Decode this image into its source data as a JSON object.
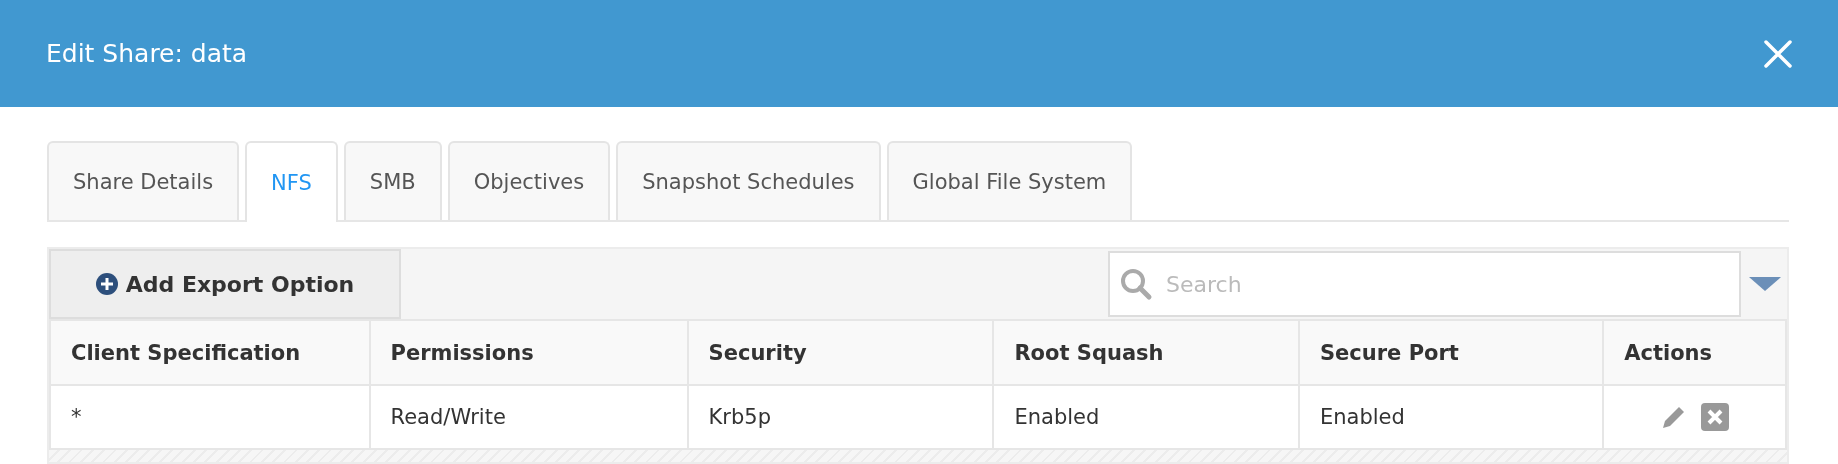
{
  "window": {
    "title": "Edit Share: data"
  },
  "tabs": [
    {
      "label": "Share Details",
      "selected": false
    },
    {
      "label": "NFS",
      "selected": true
    },
    {
      "label": "SMB",
      "selected": false
    },
    {
      "label": "Objectives",
      "selected": false
    },
    {
      "label": "Snapshot Schedules",
      "selected": false
    },
    {
      "label": "Global File System",
      "selected": false
    }
  ],
  "toolbar": {
    "add_button": "Add Export Option",
    "search": {
      "placeholder": "Search"
    }
  },
  "table": {
    "columns": [
      "Client Specification",
      "Permissions",
      "Security",
      "Root Squash",
      "Secure Port",
      "Actions"
    ],
    "rows": [
      {
        "cells": [
          "*",
          "Read/Write",
          "Krb5p",
          "Enabled",
          "Enabled"
        ]
      }
    ]
  }
}
